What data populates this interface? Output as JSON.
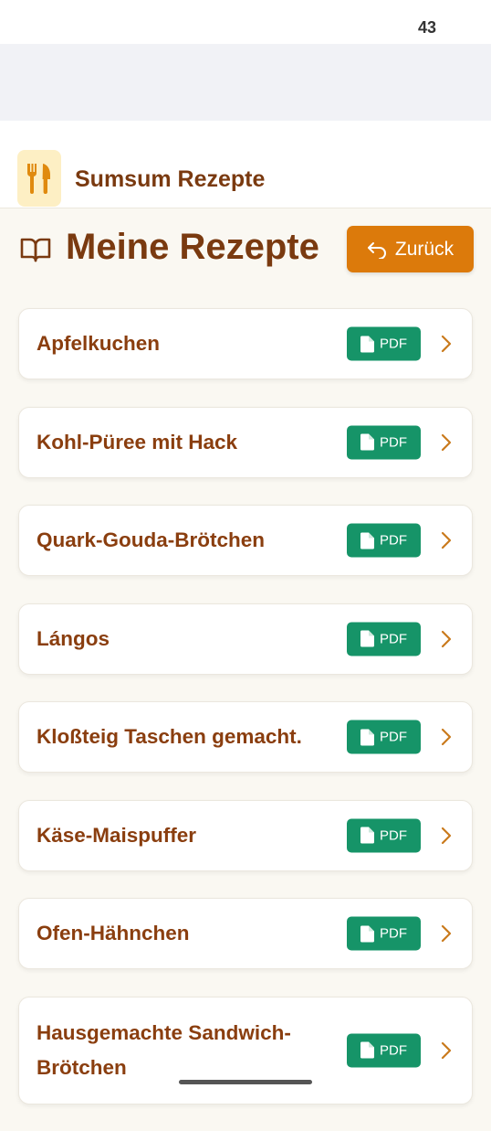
{
  "status_bar": {
    "battery": "43"
  },
  "header": {
    "logo_icon": "fork-knife-icon",
    "title": "Sumsum Rezepte"
  },
  "page": {
    "icon": "book-open-icon",
    "title": "Meine Rezepte",
    "back_button": {
      "label": "Zurück",
      "icon": "undo-arrow-icon"
    }
  },
  "recipes": [
    {
      "name": "Apfelkuchen",
      "pdf_label": "PDF"
    },
    {
      "name": "Kohl-Püree mit Hack",
      "pdf_label": "PDF"
    },
    {
      "name": "Quark-Gouda-Brötchen",
      "pdf_label": "PDF"
    },
    {
      "name": "Lángos",
      "pdf_label": "PDF"
    },
    {
      "name": "Kloßteig Taschen gemacht.",
      "pdf_label": "PDF"
    },
    {
      "name": "Käse-Maispuffer",
      "pdf_label": "PDF"
    },
    {
      "name": "Ofen-Hähnchen",
      "pdf_label": "PDF"
    },
    {
      "name": "Hausgemachte Sandwich-Brötchen",
      "pdf_label": "PDF"
    }
  ],
  "colors": {
    "brand_brown": "#7a3a10",
    "accent_orange": "#dc7a0b",
    "pdf_green": "#169468",
    "background": "#faf8f2"
  }
}
